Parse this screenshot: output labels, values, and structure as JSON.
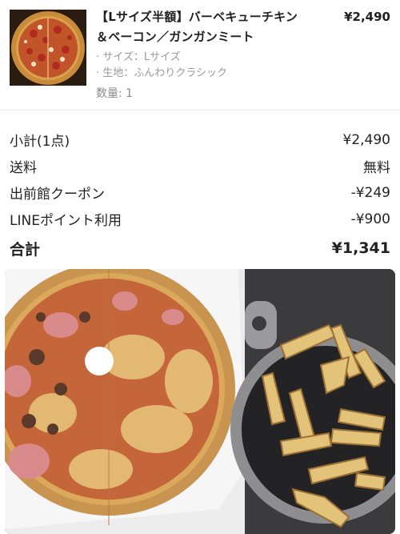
{
  "item": {
    "title": "【Lサイズ半額】バーベキューチキン＆ベーコン／ガンガンミート",
    "price": "¥2,490",
    "options": [
      "· サイズ：Lサイズ",
      "· 生地：ふんわりクラシック"
    ],
    "quantity": "数量: 1",
    "thumbnail_icon": "pizza-thumbnail-icon"
  },
  "summary": {
    "subtotal_label": "小計(1点)",
    "subtotal_value": "¥2,490",
    "shipping_label": "送料",
    "shipping_value": "無料",
    "coupon_label": "出前館クーポン",
    "coupon_value": "-¥249",
    "points_label": "LINEポイント利用",
    "points_value": "-¥900",
    "total_label": "合計",
    "total_value": "¥1,341"
  },
  "photo": {
    "description_icon": "pizza-and-potato-photo-icon"
  }
}
